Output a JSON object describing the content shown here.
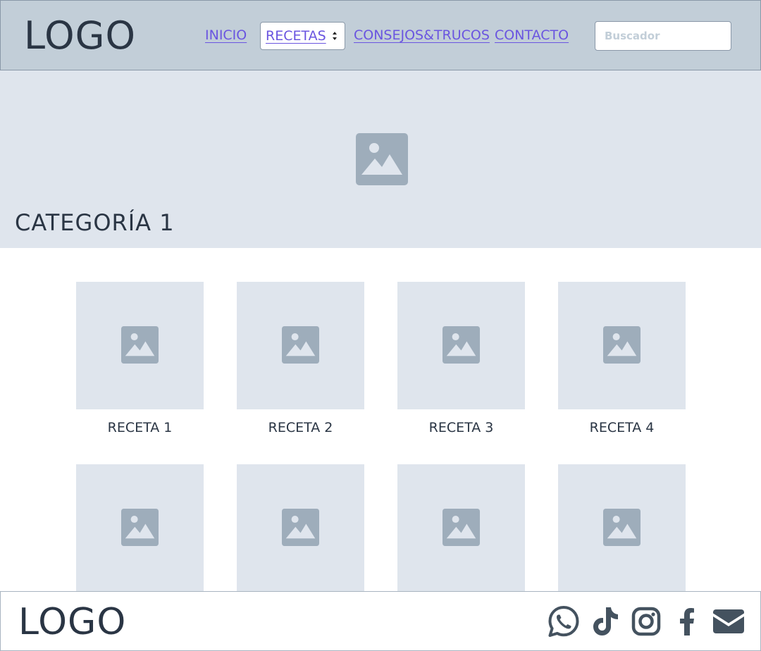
{
  "header": {
    "logo": "LOGO",
    "nav": {
      "inicio": "INICIO",
      "recetas": "RECETAS",
      "consejos": "CONSEJOS&TRUCOS",
      "contacto": "CONTACTO"
    },
    "search": {
      "placeholder": "Buscador",
      "value": ""
    }
  },
  "hero": {
    "title": "CATEGORÍA 1",
    "image_icon": "image-placeholder-icon"
  },
  "recipes": [
    {
      "title": "RECETA 1"
    },
    {
      "title": "RECETA 2"
    },
    {
      "title": "RECETA 3"
    },
    {
      "title": "RECETA 4"
    },
    {
      "title": ""
    },
    {
      "title": ""
    },
    {
      "title": ""
    },
    {
      "title": ""
    }
  ],
  "footer": {
    "logo": "LOGO",
    "social_icons": [
      "whatsapp-icon",
      "tiktok-icon",
      "instagram-icon",
      "facebook-icon",
      "email-icon"
    ]
  },
  "colors": {
    "header_bg": "#c2ced8",
    "placeholder_bg": "#dfe5ed",
    "icon_gray": "#9eadbb",
    "link": "#6a55e0",
    "text_dark": "#2a3544",
    "social_dark": "#44525f"
  }
}
